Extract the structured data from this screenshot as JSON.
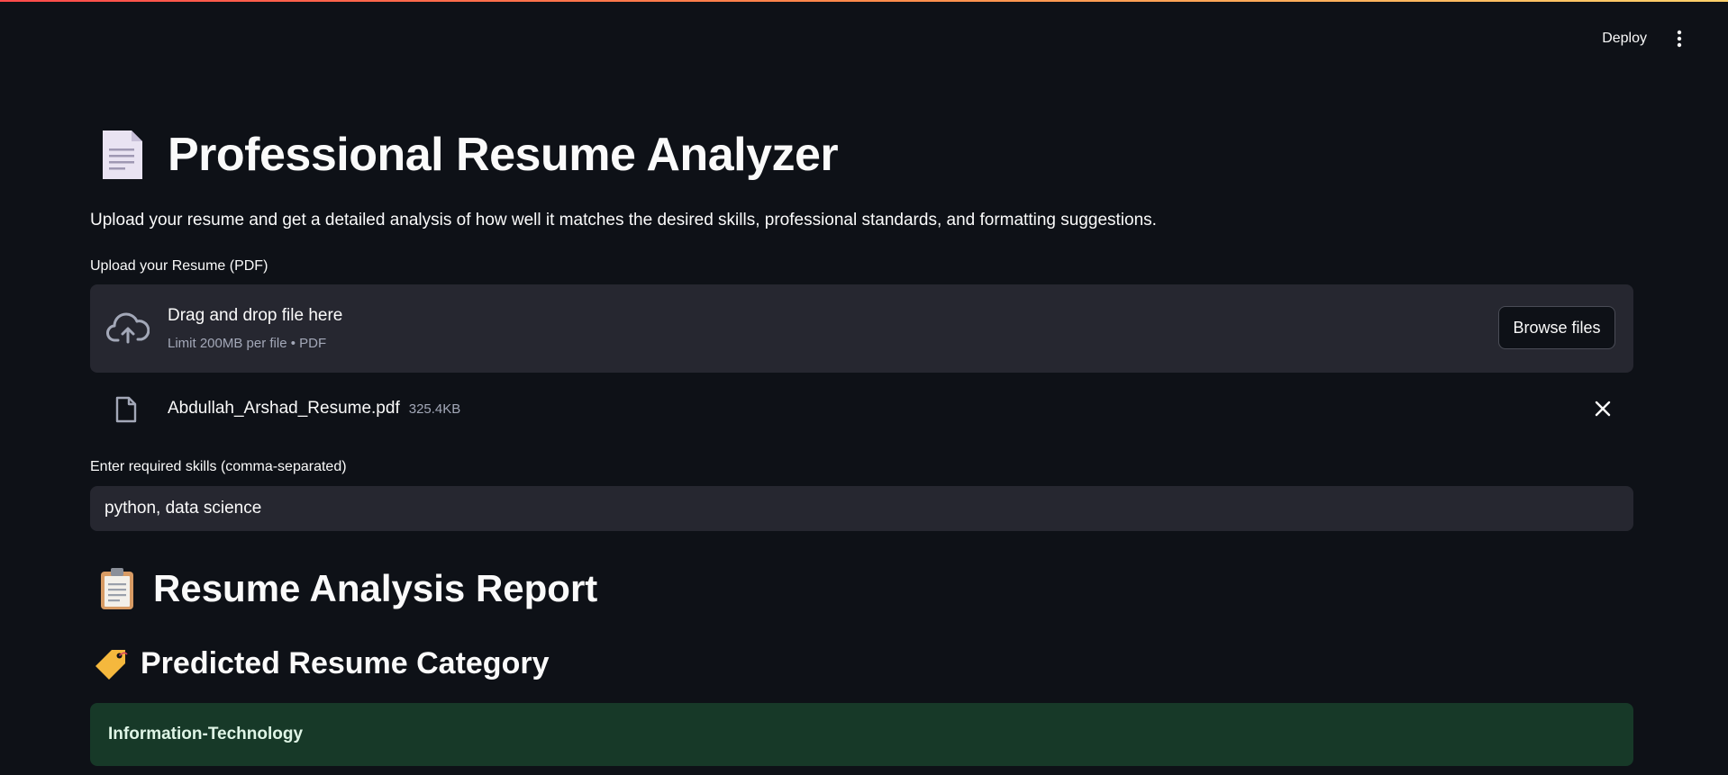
{
  "header": {
    "deploy_label": "Deploy",
    "menu_icon": "kebab-menu-icon"
  },
  "title": {
    "icon": "document-emoji",
    "text": "Professional Resume Analyzer"
  },
  "description": "Upload your resume and get a detailed analysis of how well it matches the desired skills, professional standards, and formatting suggestions.",
  "uploader": {
    "label": "Upload your Resume (PDF)",
    "icon": "cloud-upload-icon",
    "drop_text": "Drag and drop file here",
    "limit_text": "Limit 200MB per file • PDF",
    "browse_label": "Browse files"
  },
  "uploaded_file": {
    "icon": "file-icon",
    "name": "Abdullah_Arshad_Resume.pdf",
    "size": "325.4KB",
    "remove_icon": "close-icon"
  },
  "skills": {
    "label": "Enter required skills (comma-separated)",
    "value": "python, data science"
  },
  "report": {
    "icon": "clipboard-emoji",
    "heading": "Resume Analysis Report"
  },
  "category": {
    "icon": "label-tag-emoji",
    "heading": "Predicted Resume Category",
    "value": "Information-Technology"
  },
  "colors": {
    "background": "#0e1117",
    "panel": "#262730",
    "success_bg": "#173928"
  }
}
